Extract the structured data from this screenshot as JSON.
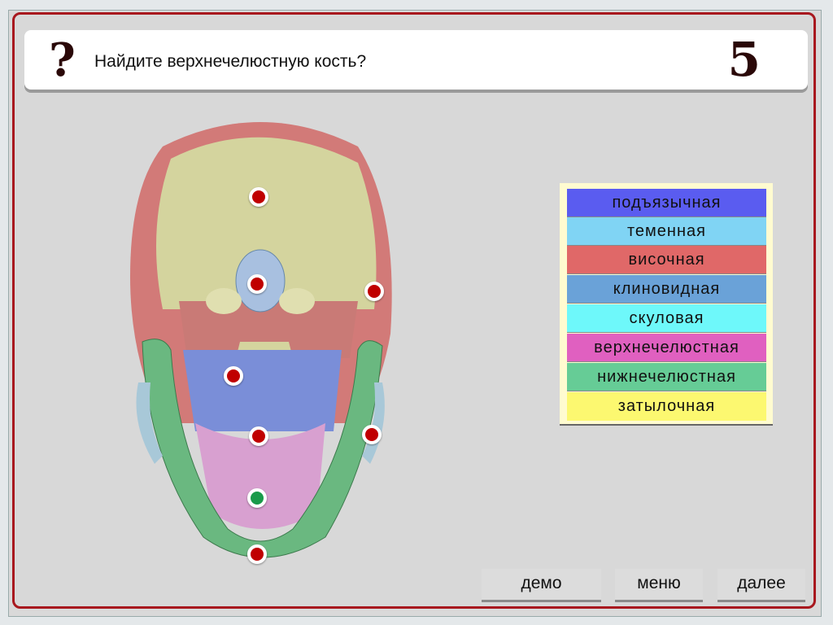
{
  "question": {
    "icon": "question-mark-icon",
    "mark": "?",
    "text": "Найдите верхнечелюстную кость?",
    "number": "5"
  },
  "legend": [
    {
      "label": "подъязычная",
      "color": "#5a5cf0"
    },
    {
      "label": "теменная",
      "color": "#80d4f4"
    },
    {
      "label": "височная",
      "color": "#e06868"
    },
    {
      "label": "клиновидная",
      "color": "#6aa2d8"
    },
    {
      "label": "скуловая",
      "color": "#6ef8fa"
    },
    {
      "label": "верхнечелюстная",
      "color": "#e060c0"
    },
    {
      "label": "нижнечелюстная",
      "color": "#66cc96"
    },
    {
      "label": "затылочная",
      "color": "#fcf870"
    }
  ],
  "markers": [
    {
      "state": "unanswered"
    },
    {
      "state": "unanswered"
    },
    {
      "state": "unanswered"
    },
    {
      "state": "unanswered"
    },
    {
      "state": "unanswered"
    },
    {
      "state": "unanswered"
    },
    {
      "state": "correct"
    },
    {
      "state": "unanswered"
    }
  ],
  "buttons": {
    "demo": "демо",
    "menu": "меню",
    "next": "далее"
  }
}
